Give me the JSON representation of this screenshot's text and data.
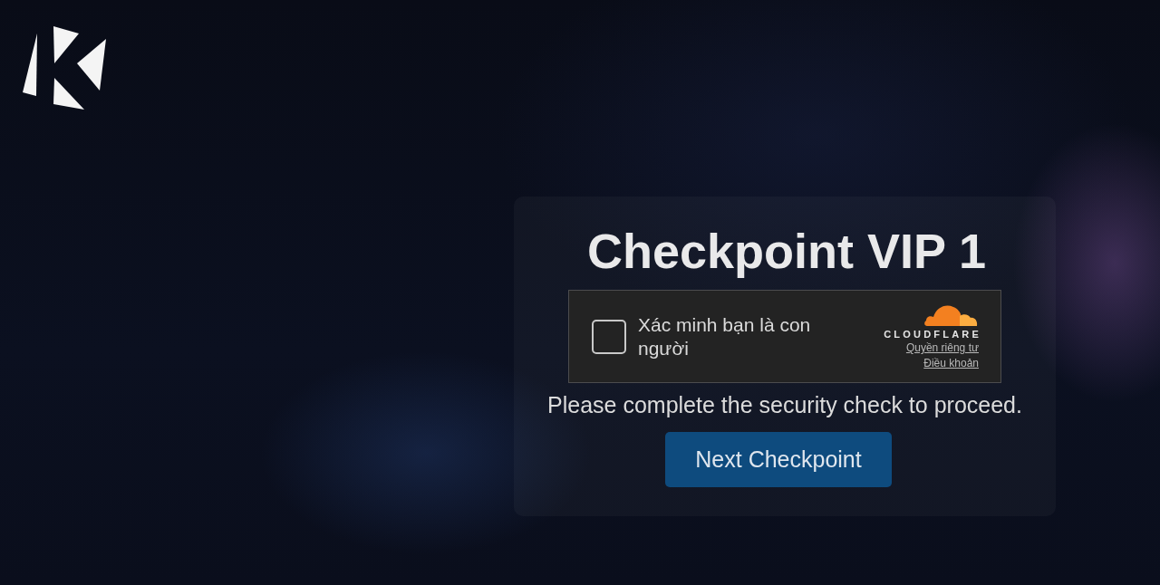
{
  "title": "Checkpoint VIP 1",
  "captcha": {
    "checked": false,
    "label": "Xác minh bạn là con người",
    "brand": "CLOUDFLARE",
    "links": [
      "Quyền riêng tư",
      "Điều khoản"
    ]
  },
  "message": "Please complete the security check to proceed.",
  "button": {
    "label": "Next Checkpoint"
  }
}
